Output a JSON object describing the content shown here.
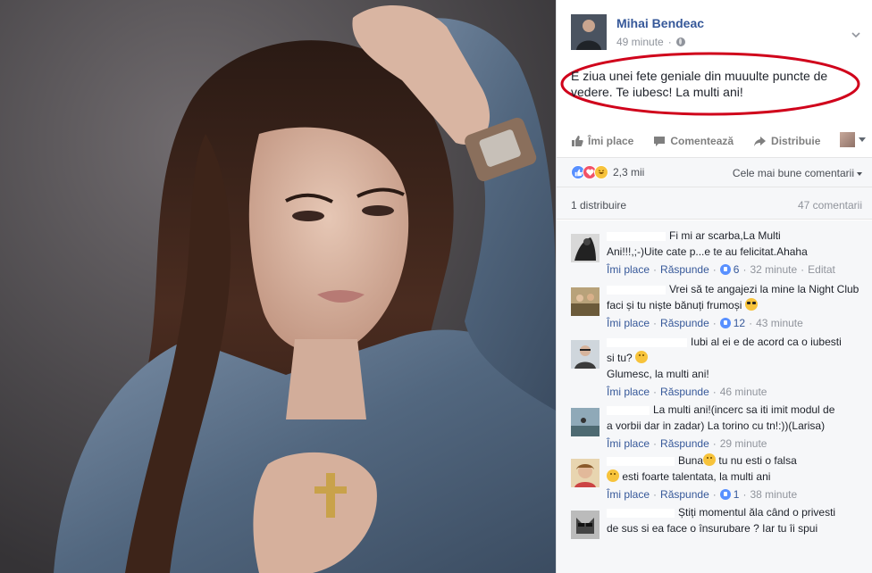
{
  "post": {
    "author": "Mihai Bendeac",
    "time": "49 minute",
    "text": "E ziua unei fete geniale din muuulte puncte de vedere. Te iubesc! La multi ani!"
  },
  "actions": {
    "like": "Îmi place",
    "comment": "Comentează",
    "share": "Distribuie"
  },
  "reactions": {
    "count": "2,3 mii",
    "sort_label": "Cele mai bune comentarii"
  },
  "stats": {
    "shares": "1 distribuire",
    "comments": "47 comentarii"
  },
  "comment_actions": {
    "like": "Îmi place",
    "reply": "Răspunde"
  },
  "comments": [
    {
      "line1": "Fi mi ar scarba,La Multi",
      "line2": "Ani!!!,;-)Uite cate p...e te au felicitat.Ahaha",
      "likes": "6",
      "time": "32 minute",
      "edited": "Editat"
    },
    {
      "line1": "Vrei să te angajezi la mine la Night Club",
      "line2": "faci și tu niște bănuți frumoși",
      "likes": "12",
      "time": "43 minute"
    },
    {
      "line1": "Iubi al ei e de acord ca o iubesti",
      "line2": "si tu?",
      "line3": "Glumesc, la multi ani!",
      "time": "46 minute"
    },
    {
      "line1": "La multi ani!(incerc sa iti imit modul de",
      "line2": "a vorbii dar in zadar) La torino cu tn!:))(Larisa)",
      "time": "29 minute"
    },
    {
      "line1": "Buna",
      "line1b": "tu nu esti o falsa",
      "line2": "esti foarte talentata, la multi ani",
      "likes": "1",
      "time": "38 minute"
    },
    {
      "line1": "Știți momentul ăla când o privesti",
      "line2": "de sus si ea face o însurubare ? Iar tu îi spui"
    }
  ],
  "colors": {
    "link": "#365899",
    "meta": "#90949c",
    "highlight_ring": "#d0021b",
    "like_blue": "#5890ff"
  }
}
